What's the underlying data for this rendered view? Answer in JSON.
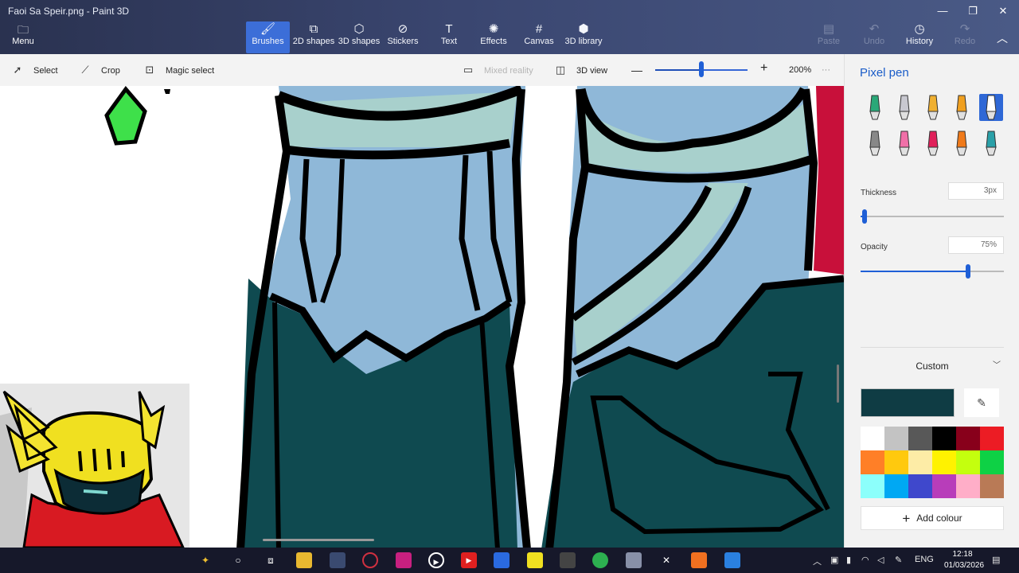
{
  "window": {
    "title": "Faoi Sa Speir.png - Paint 3D",
    "minimize": "—",
    "restore": "❐",
    "close": "✕"
  },
  "ribbon": {
    "menu": "Menu",
    "tools": [
      {
        "label": "Brushes",
        "icon": "brush-icon"
      },
      {
        "label": "2D shapes",
        "icon": "2d-shapes-icon"
      },
      {
        "label": "3D shapes",
        "icon": "3d-shapes-icon"
      },
      {
        "label": "Stickers",
        "icon": "stickers-icon"
      },
      {
        "label": "Text",
        "icon": "text-icon"
      },
      {
        "label": "Effects",
        "icon": "effects-icon"
      },
      {
        "label": "Canvas",
        "icon": "canvas-icon"
      },
      {
        "label": "3D library",
        "icon": "3d-library-icon"
      }
    ],
    "paste": "Paste",
    "undo": "Undo",
    "history": "History",
    "redo": "Redo"
  },
  "toolbar": {
    "select": "Select",
    "crop": "Crop",
    "magic_select": "Magic select",
    "mixed_reality": "Mixed reality",
    "view_3d": "3D view",
    "zoom_value": "200%",
    "zoom_level": 0.5,
    "more": "···"
  },
  "panel": {
    "title": "Pixel pen",
    "brushes": [
      {
        "name": "marker",
        "color": "#2aa878"
      },
      {
        "name": "calligraphy-pen",
        "color": "#c8c8d0"
      },
      {
        "name": "oil-brush",
        "color": "#f0b030"
      },
      {
        "name": "watercolor",
        "color": "#f0a020"
      },
      {
        "name": "pixel-pen",
        "color": "#ffffff"
      },
      {
        "name": "pencil",
        "color": "#888888"
      },
      {
        "name": "eraser",
        "color": "#f070a8"
      },
      {
        "name": "crayon",
        "color": "#e0205a"
      },
      {
        "name": "spray-can",
        "color": "#f07a1a"
      },
      {
        "name": "fill",
        "color": "#2aa0a8"
      }
    ],
    "thickness_label": "Thickness",
    "thickness_value": "3px",
    "thickness_level": 0.03,
    "opacity_label": "Opacity",
    "opacity_value": "75%",
    "opacity_level": 0.75,
    "color_mode": "Custom",
    "current_color": "#0f3c44",
    "palette": [
      "#ffffff",
      "#c3c3c3",
      "#585858",
      "#000000",
      "#88001b",
      "#ec1c24",
      "#ff7f27",
      "#ffc90e",
      "#fdeca6",
      "#fff200",
      "#c4ff0e",
      "#0ed145",
      "#8cfffb",
      "#00a8f3",
      "#3f48cc",
      "#b83dba",
      "#ffaec8",
      "#b97a56"
    ],
    "add_colour": "Add colour"
  },
  "taskbar": {
    "language": "ENG",
    "time": "12:18",
    "date": "01/03/2026"
  }
}
